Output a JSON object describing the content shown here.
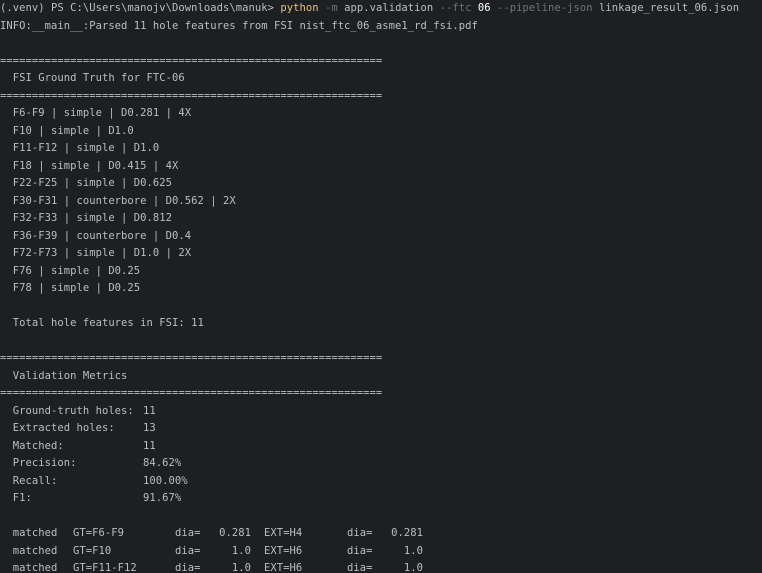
{
  "terminal": {
    "command": {
      "prompt": "(.venv) PS C:\\Users\\manojv\\Downloads\\manuk> ",
      "program": "python",
      "sp1": " ",
      "flag1": "-m",
      "sp2": " ",
      "module": "app.validation",
      "sp3": " ",
      "flag2": "--ftc",
      "sp4": " ",
      "ftc_value": "06",
      "sp5": " ",
      "flag3": "--pipeline-json",
      "sp6": " ",
      "json_file": "linkage_result_06.json"
    },
    "info_line": "INFO:__main__:Parsed 11 hole features from FSI nist_ftc_06_asme1_rd_fsi.pdf",
    "separator": "============================================================",
    "fsi_title": "  FSI Ground Truth for FTC-06",
    "features": [
      "  F6-F9 | simple | D0.281 | 4X",
      "  F10 | simple | D1.0",
      "  F11-F12 | simple | D1.0",
      "  F18 | simple | D0.415 | 4X",
      "  F22-F25 | simple | D0.625",
      "  F30-F31 | counterbore | D0.562 | 2X",
      "  F32-F33 | simple | D0.812",
      "  F36-F39 | counterbore | D0.4",
      "  F72-F73 | simple | D1.0 | 2X",
      "  F76 | simple | D0.25",
      "  F78 | simple | D0.25"
    ],
    "total_line": "  Total hole features in FSI: 11",
    "metrics_title": "  Validation Metrics",
    "metrics": [
      {
        "label": "  Ground-truth holes:",
        "value": "11"
      },
      {
        "label": "  Extracted holes:",
        "value": "13"
      },
      {
        "label": "  Matched:",
        "value": "11"
      },
      {
        "label": "  Precision:",
        "value": "84.62%"
      },
      {
        "label": "  Recall:",
        "value": "100.00%"
      },
      {
        "label": "  F1:",
        "value": "91.67%"
      }
    ],
    "matches": [
      {
        "status": "  matched",
        "gt": "GT=F6-F9",
        "dia1_label": "dia=",
        "dia1": "0.281",
        "ext": "EXT=H4",
        "dia2_label": "dia=",
        "dia2": "0.281"
      },
      {
        "status": "  matched",
        "gt": "GT=F10",
        "dia1_label": "dia=",
        "dia1": "1.0",
        "ext": "EXT=H6",
        "dia2_label": "dia=",
        "dia2": "1.0"
      },
      {
        "status": "  matched",
        "gt": "GT=F11-F12",
        "dia1_label": "dia=",
        "dia1": "1.0",
        "ext": "EXT=H6",
        "dia2_label": "dia=",
        "dia2": "1.0"
      }
    ]
  }
}
